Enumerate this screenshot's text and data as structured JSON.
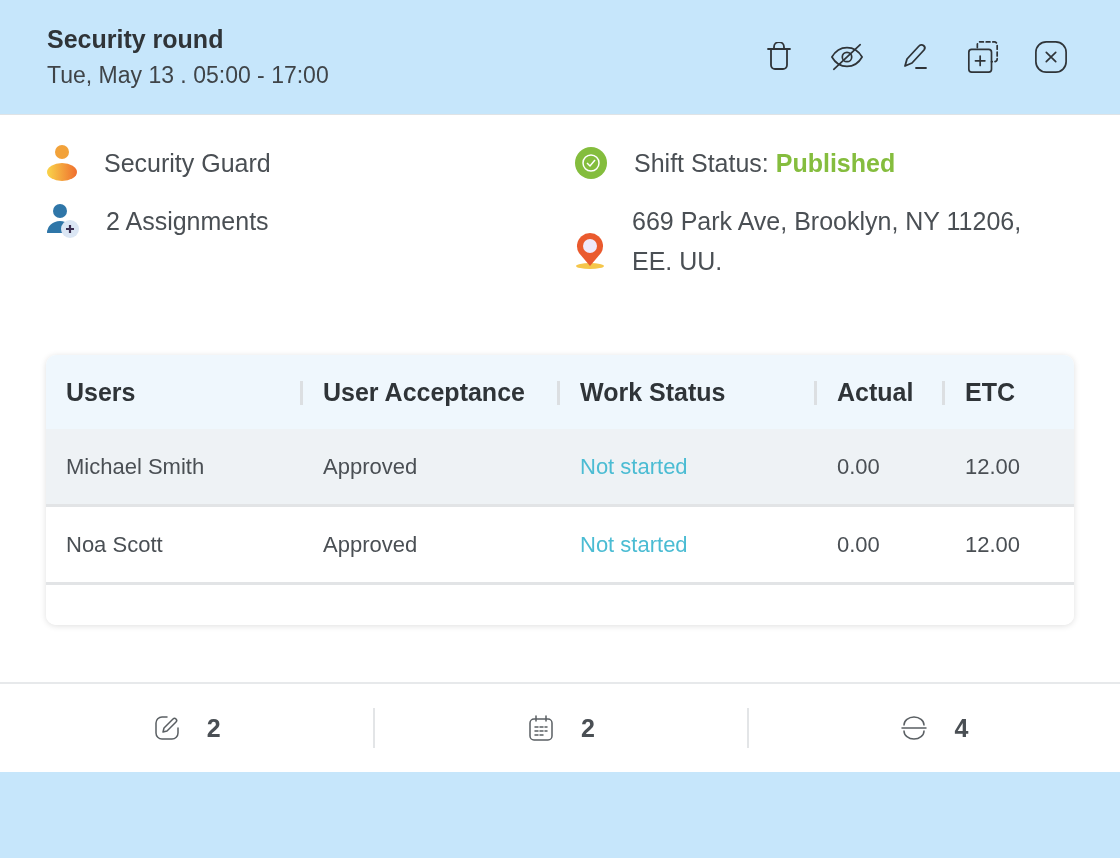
{
  "header": {
    "title": "Security round",
    "subtitle": "Tue, May 13 . 05:00 - 17:00",
    "actions": [
      {
        "kind": "delete"
      },
      {
        "kind": "hide"
      },
      {
        "kind": "edit"
      },
      {
        "kind": "duplicate"
      },
      {
        "kind": "close"
      }
    ]
  },
  "details": {
    "role": "Security Guard",
    "assignments": "2 Assignments",
    "status_label": "Shift Status:",
    "status_value": "Published",
    "address": "669 Park Ave, Brooklyn, NY 11206, EE. UU."
  },
  "table": {
    "columns": [
      "Users",
      "User Acceptance",
      "Work Status",
      "Actual",
      "ETC"
    ],
    "rows": [
      {
        "user": "Michael Smith",
        "acceptance": "Approved",
        "work_status": "Not started",
        "actuals": "0.00",
        "etc": "12.00",
        "selected": true
      },
      {
        "user": "Noa Scott",
        "acceptance": "Approved",
        "work_status": "Not started",
        "actuals": "0.00",
        "etc": "12.00",
        "selected": false
      }
    ]
  },
  "stats": [
    {
      "kind": "edit",
      "value": "2"
    },
    {
      "kind": "calendar",
      "value": "2"
    },
    {
      "kind": "scan",
      "value": "4"
    }
  ]
}
